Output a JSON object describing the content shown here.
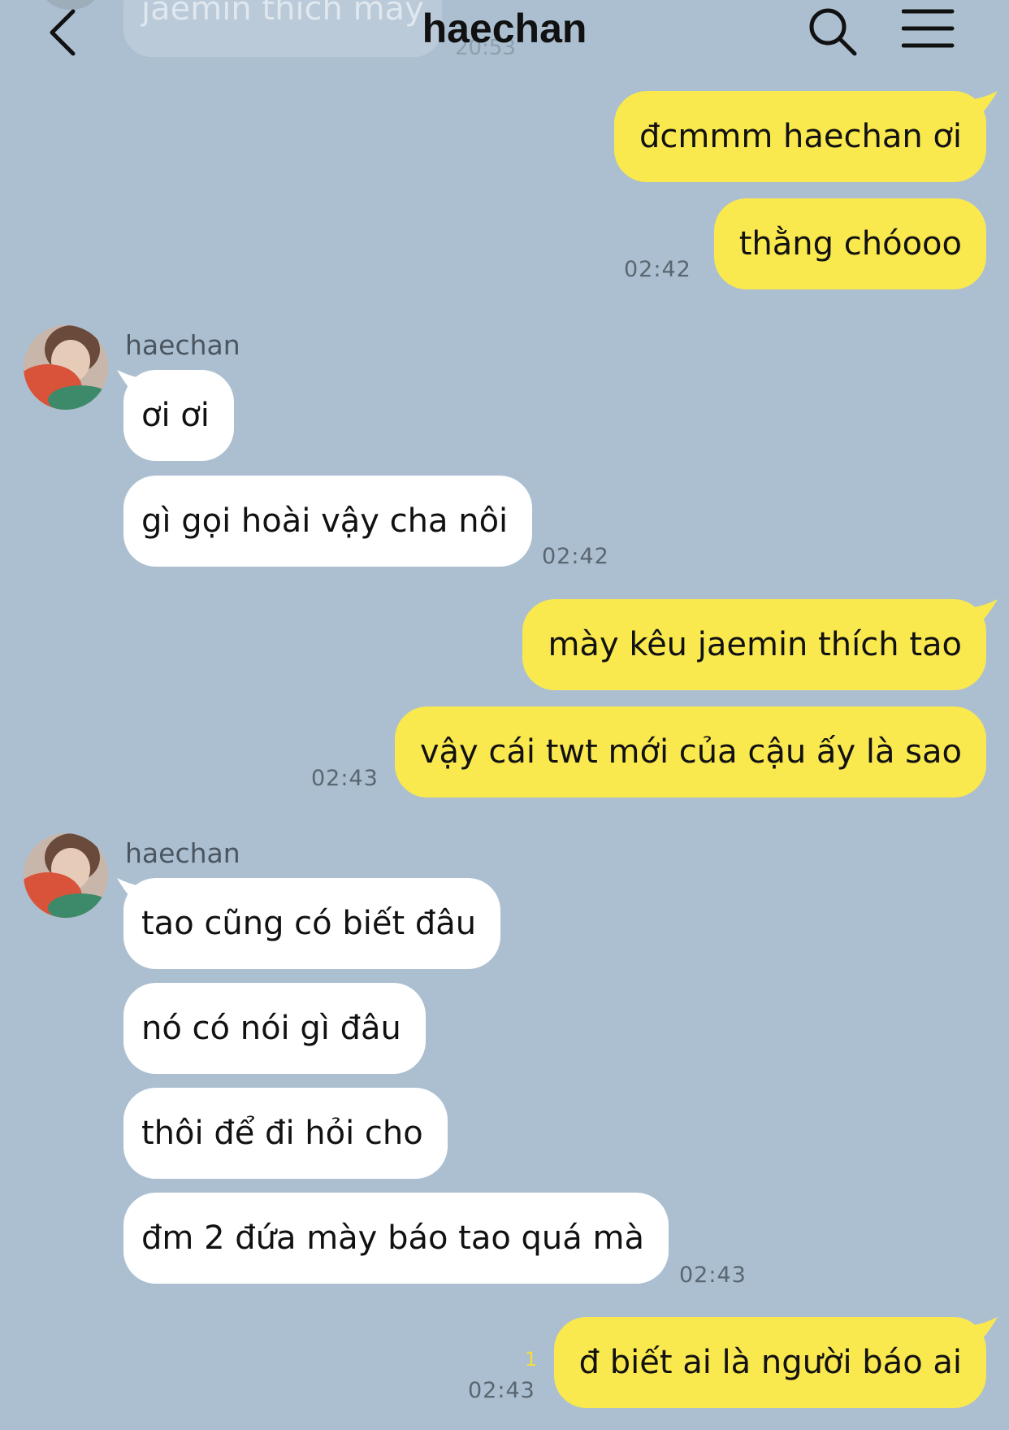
{
  "header": {
    "title": "haechan",
    "back_icon": "chevron-left-icon",
    "search_icon": "search-icon",
    "menu_icon": "hamburger-menu-icon"
  },
  "faded_previous": {
    "text": "jaemin thích mày",
    "time": "20:53"
  },
  "colors": {
    "background": "#abbfd1",
    "mine_bubble": "#fae84f",
    "their_bubble": "#ffffff",
    "read_count": "#f4dc3c"
  },
  "messages": {
    "m1": "đcmmm haechan ơi",
    "m2": "thằng chóooo",
    "t1": "02:42",
    "g1_sender": "haechan",
    "m3": "ơi ơi",
    "m4": "gì gọi hoài vậy cha nôi",
    "t2": "02:42",
    "m5": "mày kêu jaemin thích tao",
    "m6": "vậy cái twt mới của cậu ấy là sao",
    "t3": "02:43",
    "g2_sender": "haechan",
    "m7": "tao cũng có biết đâu",
    "m8": "nó có nói gì đâu",
    "m9": "thôi để đi hỏi cho",
    "m10": "đm 2 đứa mày báo tao quá mà",
    "t4": "02:43",
    "m11": "đ biết ai là người báo ai",
    "read_count": "1",
    "t5": "02:43"
  }
}
